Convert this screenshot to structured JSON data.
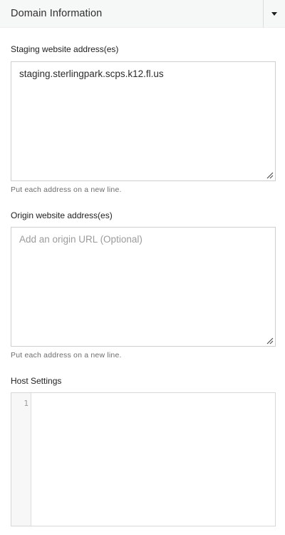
{
  "panel": {
    "title": "Domain Information",
    "toggle_icon": "caret-down-icon"
  },
  "staging": {
    "label": "Staging website address(es)",
    "value": "staging.sterlingpark.scps.k12.fl.us",
    "help": "Put each address on a new line."
  },
  "origin": {
    "label": "Origin website address(es)",
    "value": "",
    "placeholder": "Add an origin URL (Optional)",
    "help": "Put each address on a new line."
  },
  "host": {
    "label": "Host Settings",
    "line_numbers": [
      "1"
    ],
    "code": ""
  }
}
